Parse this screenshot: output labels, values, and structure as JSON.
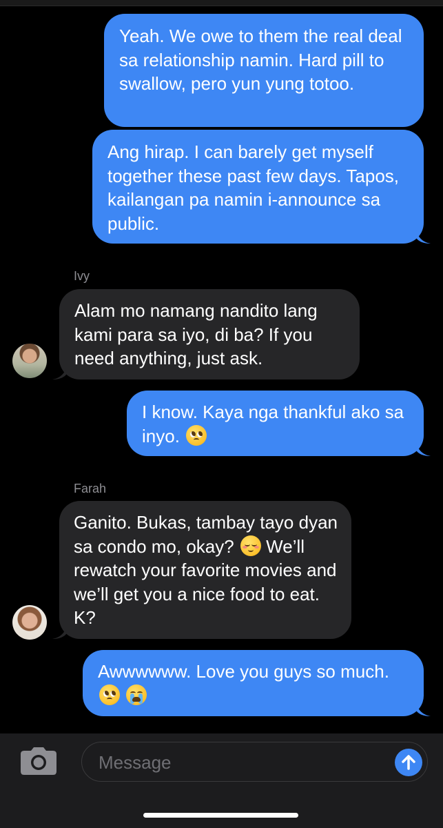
{
  "colors": {
    "background": "#000000",
    "outgoing_bubble": "#3e87f4",
    "incoming_bubble": "#262628",
    "sender_name": "#8e8e93",
    "input_border": "#3a3a3c"
  },
  "messages": [
    {
      "direction": "outgoing",
      "text": "Yeah. We owe to them the real deal sa relationship namin. Hard pill to swallow, pero yun yung totoo."
    },
    {
      "direction": "outgoing",
      "text": "Ang hirap. I can barely get myself together these past few days. Tapos, kailangan pa namin i-announce sa public."
    },
    {
      "direction": "incoming",
      "sender": "Ivy",
      "avatar": "ivy-avatar",
      "text": "Alam mo namang nandito lang kami para sa iyo, di ba? If you need anything, just ask."
    },
    {
      "direction": "outgoing",
      "text": "I know. Kaya nga thankful ako sa inyo.",
      "emojis": [
        "pleading-face-emoji"
      ]
    },
    {
      "direction": "incoming",
      "sender": "Farah",
      "avatar": "farah-avatar",
      "text_a": "Ganito. Bukas, tambay tayo dyan sa condo mo, okay?",
      "text_b": "We’ll rewatch your favorite movies and we’ll get you a nice food to eat. K?",
      "emojis": [
        "smiling-face-emoji"
      ]
    },
    {
      "direction": "outgoing",
      "text": "Awwwwww. Love you guys so much.",
      "emojis": [
        "pleading-face-emoji",
        "loudly-crying-face-emoji"
      ]
    }
  ],
  "composer": {
    "placeholder": "Message",
    "camera_icon": "camera-icon",
    "send_icon": "arrow-up-icon"
  }
}
